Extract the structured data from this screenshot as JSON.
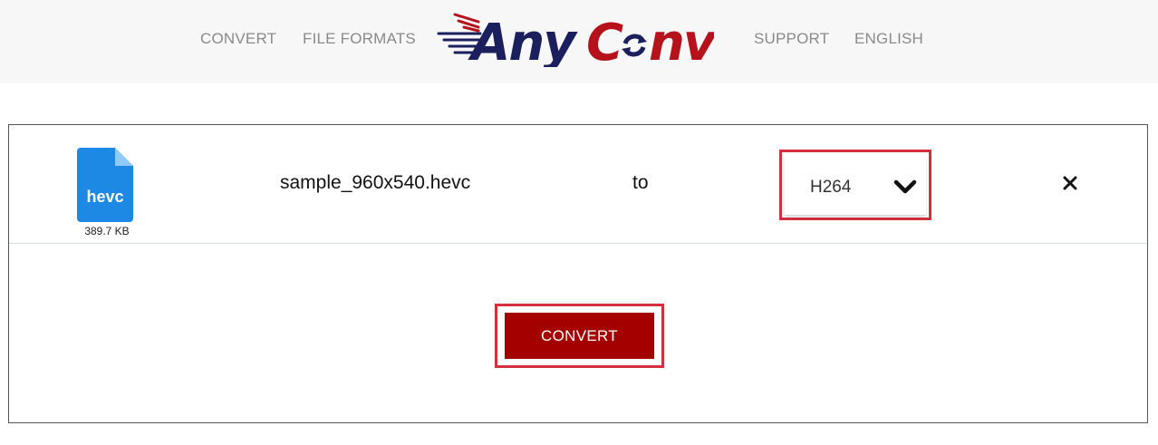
{
  "header": {
    "nav_left": [
      {
        "label": "CONVERT"
      },
      {
        "label": "FILE FORMATS"
      }
    ],
    "nav_right": [
      {
        "label": "SUPPORT"
      },
      {
        "label": "ENGLISH"
      }
    ],
    "logo": {
      "text_part1": "Any",
      "text_part2": "C",
      "text_part3": "nv",
      "color_dark": "#1b1f5e",
      "color_red": "#b5121b"
    }
  },
  "file_row": {
    "file_icon": {
      "name": "file-icon",
      "extension": "hevc",
      "color": "#1e88e5"
    },
    "file_size": "389.7 KB",
    "file_name": "sample_960x540.hevc",
    "to_label": "to",
    "format_select": {
      "selected": "H264",
      "icon": "chevron-down-icon"
    },
    "remove_icon": "close-icon"
  },
  "actions": {
    "convert_label": "CONVERT",
    "convert_color": "#a50000",
    "highlight_color": "#d32f3f"
  }
}
